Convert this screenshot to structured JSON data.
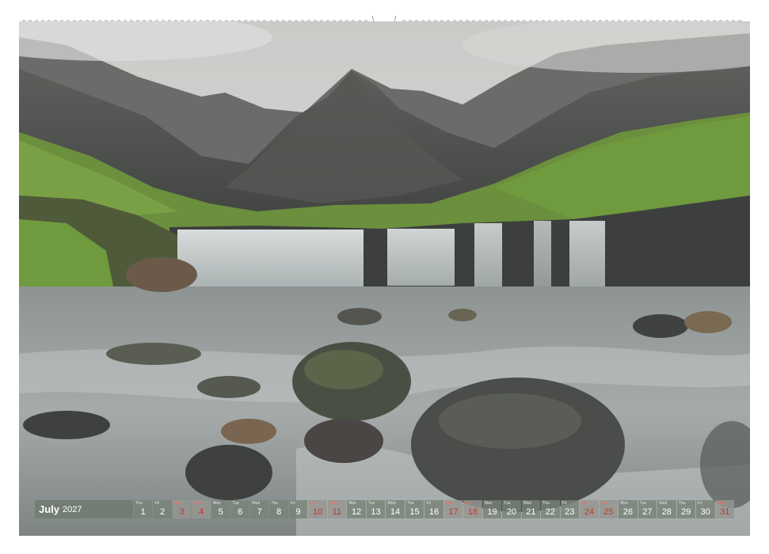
{
  "calendar": {
    "month": "July",
    "year": "2027",
    "days": [
      {
        "wd": "Thu",
        "num": "1",
        "weekend": false
      },
      {
        "wd": "Fri",
        "num": "2",
        "weekend": false
      },
      {
        "wd": "Sat",
        "num": "3",
        "weekend": true
      },
      {
        "wd": "Sun",
        "num": "4",
        "weekend": true
      },
      {
        "wd": "Mon",
        "num": "5",
        "weekend": false
      },
      {
        "wd": "Tue",
        "num": "6",
        "weekend": false
      },
      {
        "wd": "Wed",
        "num": "7",
        "weekend": false
      },
      {
        "wd": "Thu",
        "num": "8",
        "weekend": false
      },
      {
        "wd": "Fri",
        "num": "9",
        "weekend": false
      },
      {
        "wd": "Sat",
        "num": "10",
        "weekend": true
      },
      {
        "wd": "Sun",
        "num": "11",
        "weekend": true
      },
      {
        "wd": "Mon",
        "num": "12",
        "weekend": false
      },
      {
        "wd": "Tue",
        "num": "13",
        "weekend": false
      },
      {
        "wd": "Wed",
        "num": "14",
        "weekend": false
      },
      {
        "wd": "Thu",
        "num": "15",
        "weekend": false
      },
      {
        "wd": "Fri",
        "num": "16",
        "weekend": false
      },
      {
        "wd": "Sat",
        "num": "17",
        "weekend": true
      },
      {
        "wd": "Sun",
        "num": "18",
        "weekend": true
      },
      {
        "wd": "Mon",
        "num": "19",
        "weekend": false
      },
      {
        "wd": "Tue",
        "num": "20",
        "weekend": false
      },
      {
        "wd": "Wed",
        "num": "21",
        "weekend": false
      },
      {
        "wd": "Thu",
        "num": "22",
        "weekend": false
      },
      {
        "wd": "Fri",
        "num": "23",
        "weekend": false
      },
      {
        "wd": "Sat",
        "num": "24",
        "weekend": true
      },
      {
        "wd": "Sun",
        "num": "25",
        "weekend": true
      },
      {
        "wd": "Mon",
        "num": "26",
        "weekend": false
      },
      {
        "wd": "Tue",
        "num": "27",
        "weekend": false
      },
      {
        "wd": "Wed",
        "num": "28",
        "weekend": false
      },
      {
        "wd": "Thu",
        "num": "29",
        "weekend": false
      },
      {
        "wd": "Fri",
        "num": "30",
        "weekend": false
      },
      {
        "wd": "Sat",
        "num": "31",
        "weekend": true
      }
    ]
  },
  "colors": {
    "weekend_text": "#c0392b",
    "bar_bg": "#707a70",
    "sky": "#d7d9d6",
    "grass": "#5f8f35",
    "water": "#9aa19f",
    "rock": "#4a4c4a"
  },
  "icons": {
    "binding": "spiral-binding-icon",
    "hanger": "hanger-icon"
  }
}
